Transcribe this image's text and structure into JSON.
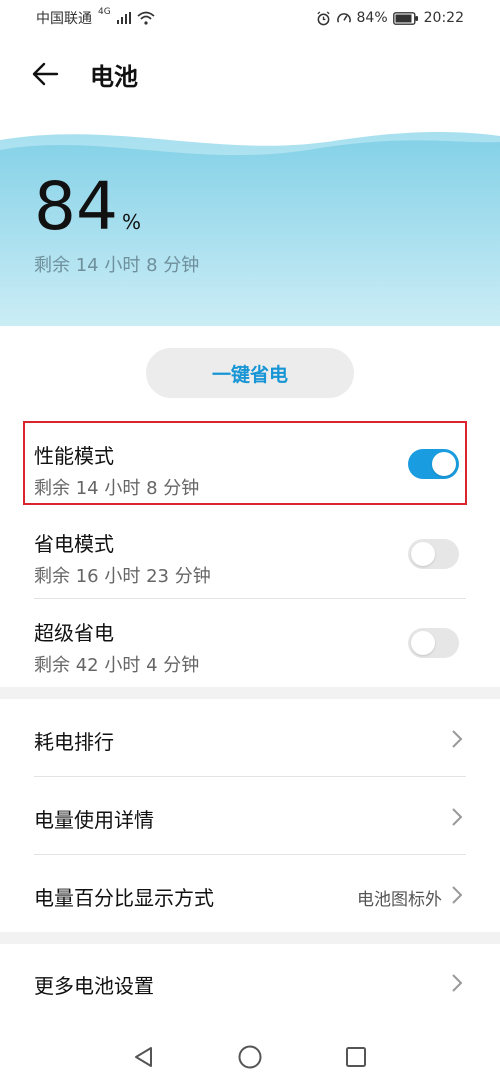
{
  "status_bar": {
    "carrier": "中国联通",
    "network": "4G",
    "battery_text": "84%",
    "time": "20:22"
  },
  "header": {
    "title": "电池",
    "back_icon": "arrow-left-icon"
  },
  "battery": {
    "percent_value": "84",
    "percent_sign": "%",
    "remaining": "剩余 14 小时 8 分钟",
    "level_fraction": 0.84
  },
  "save_button": {
    "label": "一键省电"
  },
  "modes": [
    {
      "title": "性能模式",
      "remaining": "剩余 14 小时 8 分钟",
      "enabled": true
    },
    {
      "title": "省电模式",
      "remaining": "剩余 16 小时 23 分钟",
      "enabled": false
    },
    {
      "title": "超级省电",
      "remaining": "剩余 42 小时 4 分钟",
      "enabled": false
    }
  ],
  "list_items": [
    {
      "label": "耗电排行",
      "value": ""
    },
    {
      "label": "电量使用详情",
      "value": ""
    },
    {
      "label": "电量百分比显示方式",
      "value": "电池图标外"
    },
    {
      "label": "更多电池设置",
      "value": ""
    }
  ],
  "colors": {
    "accent": "#1a9de0",
    "highlight_border": "#d9262e",
    "hero_wave_top": "#7fcfe6",
    "hero_wave_bottom": "#c9ecf5"
  },
  "nav_icons": [
    "nav-back-icon",
    "nav-home-icon",
    "nav-recents-icon"
  ]
}
